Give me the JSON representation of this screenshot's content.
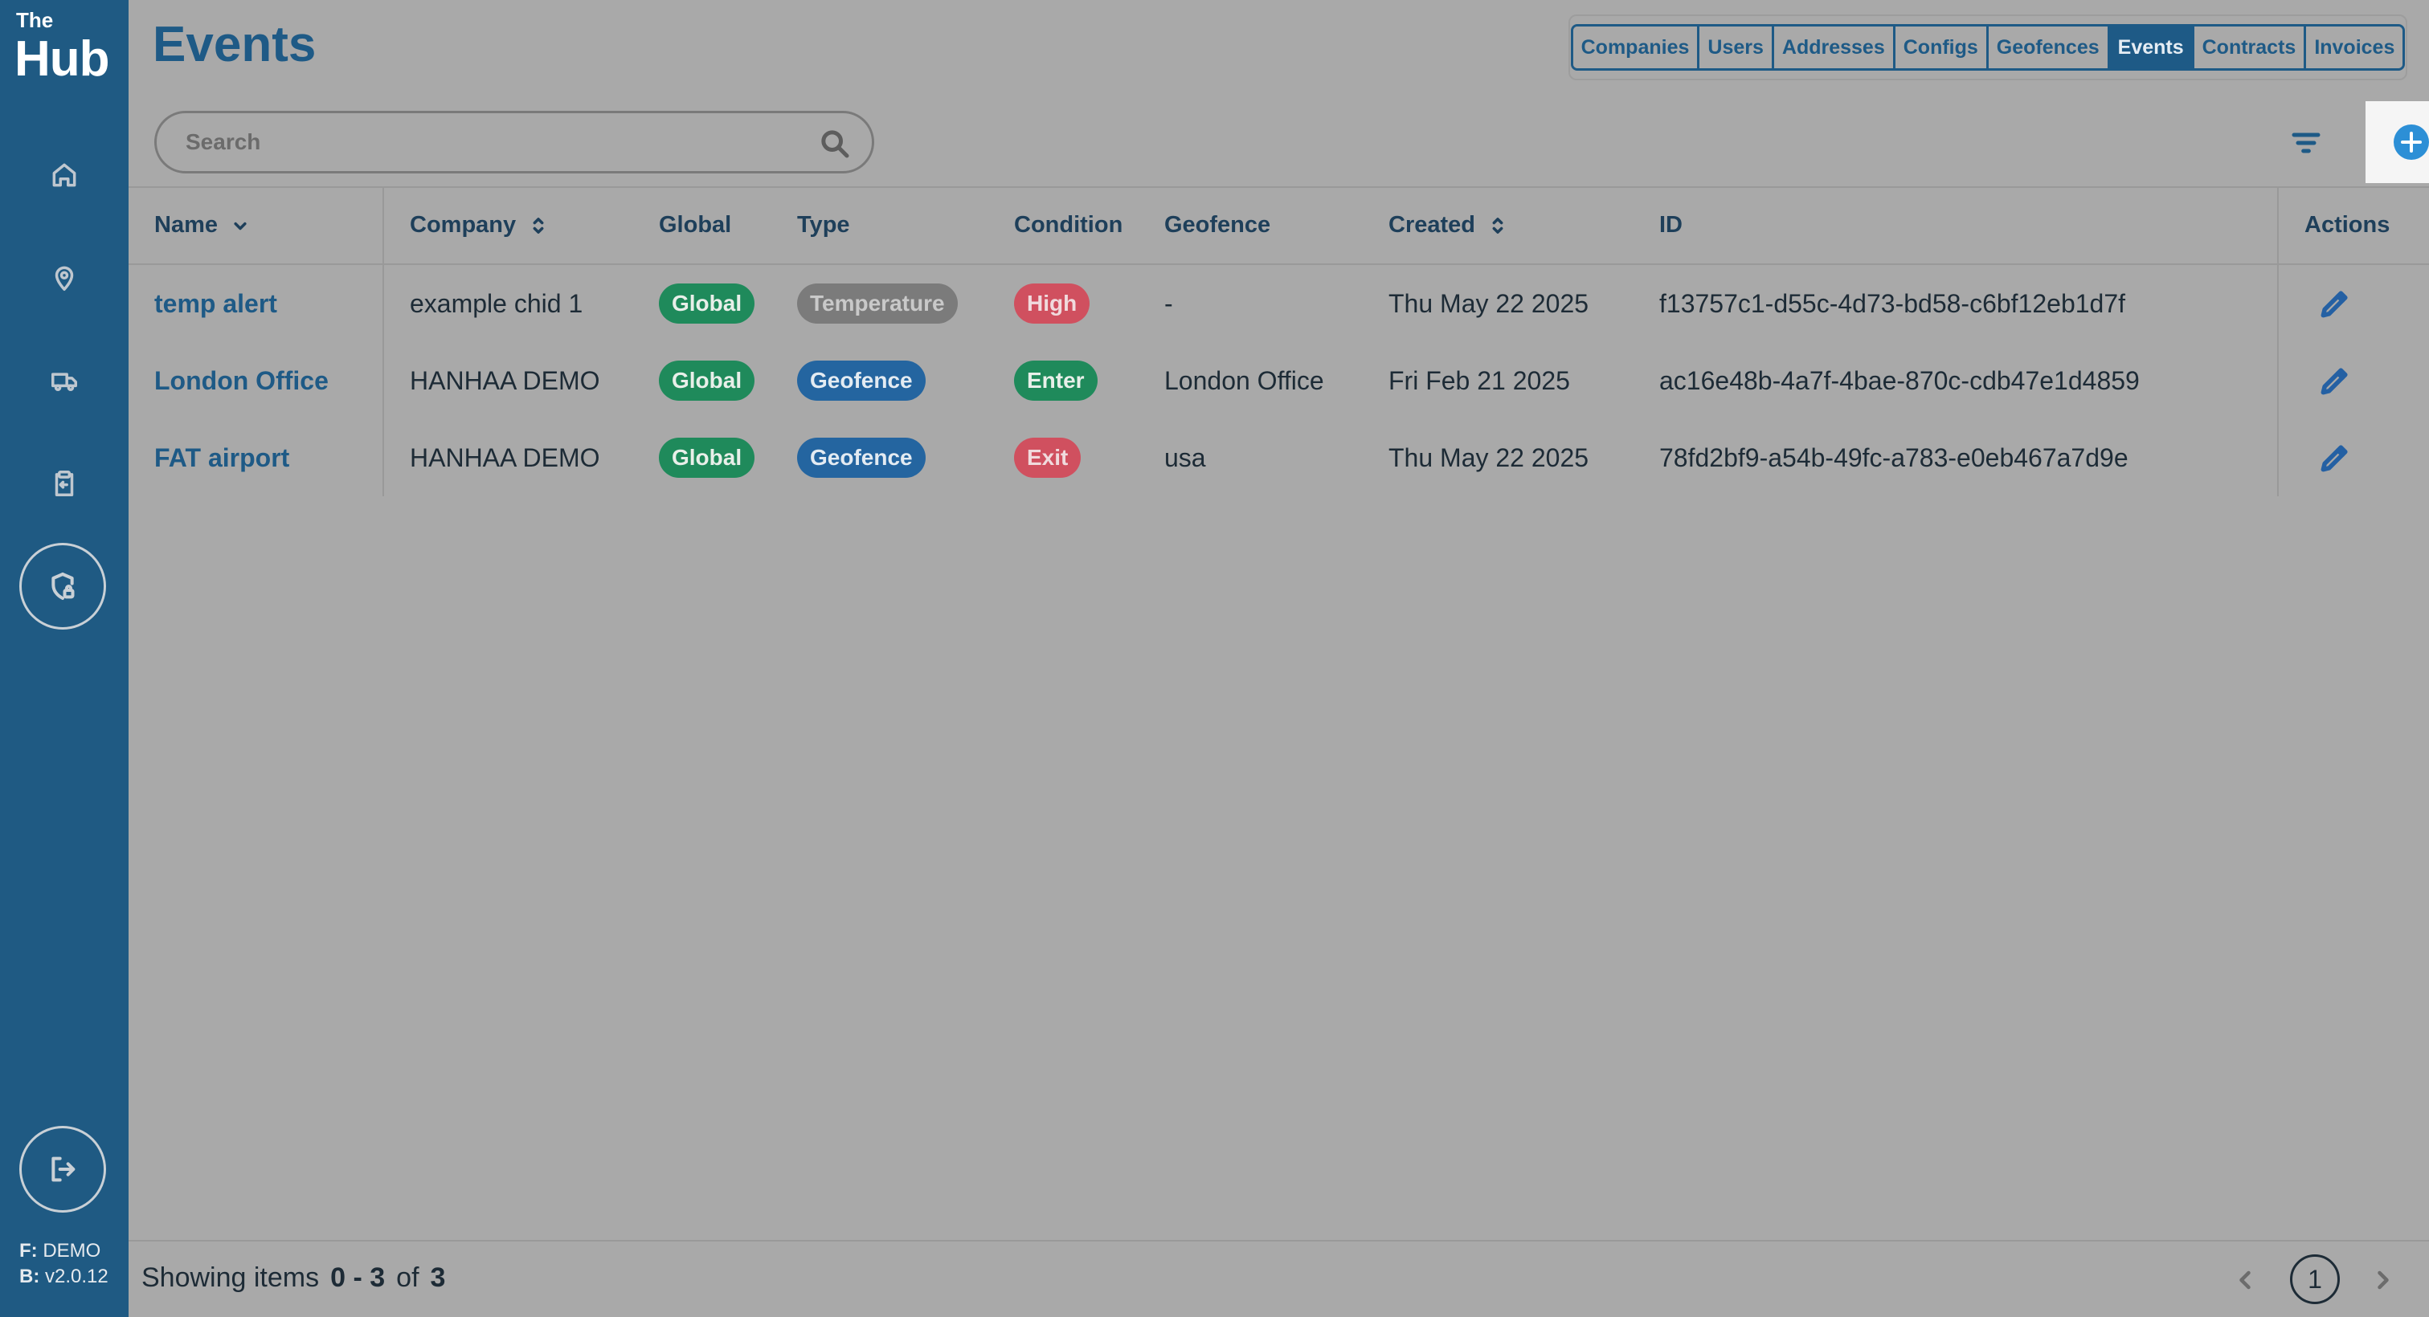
{
  "app": {
    "logo_top": "The",
    "logo_main": "Hub"
  },
  "sidebar": {
    "items": [
      {
        "icon": "home-icon"
      },
      {
        "icon": "map-pin-icon"
      },
      {
        "icon": "truck-icon"
      },
      {
        "icon": "clipboard-icon"
      },
      {
        "icon": "shield-lock-icon",
        "active": true
      }
    ],
    "logout_icon": "logout-icon",
    "frontend_label": "F:",
    "frontend_value": "DEMO",
    "backend_label": "B:",
    "backend_value": "v2.0.12"
  },
  "page": {
    "title": "Events"
  },
  "entity_tabs": [
    {
      "label": "Companies"
    },
    {
      "label": "Users"
    },
    {
      "label": "Addresses"
    },
    {
      "label": "Configs"
    },
    {
      "label": "Geofences"
    },
    {
      "label": "Events",
      "active": true
    },
    {
      "label": "Contracts"
    },
    {
      "label": "Invoices"
    }
  ],
  "search": {
    "placeholder": "Search",
    "value": ""
  },
  "table": {
    "headers": {
      "name": "Name",
      "company": "Company",
      "global": "Global",
      "type": "Type",
      "condition": "Condition",
      "geofence": "Geofence",
      "created": "Created",
      "id": "ID",
      "actions": "Actions"
    },
    "rows": [
      {
        "name": "temp alert",
        "company": "example chid 1",
        "global": "Global",
        "type": "Temperature",
        "condition": "High",
        "geofence": "-",
        "created": "Thu May 22 2025",
        "id": "f13757c1-d55c-4d73-bd58-c6bf12eb1d7f"
      },
      {
        "name": "London Office",
        "company": "HANHAA DEMO",
        "global": "Global",
        "type": "Geofence",
        "condition": "Enter",
        "geofence": "London Office",
        "created": "Fri Feb 21 2025",
        "id": "ac16e48b-4a7f-4bae-870c-cdb47e1d4859"
      },
      {
        "name": "FAT airport",
        "company": "HANHAA DEMO",
        "global": "Global",
        "type": "Geofence",
        "condition": "Exit",
        "geofence": "usa",
        "created": "Thu May 22 2025",
        "id": "78fd2bf9-a54b-49fc-a783-e0eb467a7d9e"
      }
    ]
  },
  "footer": {
    "showing_label": "Showing items",
    "range": "0 - 3",
    "of_label": "of",
    "total": "3",
    "current_page": "1"
  },
  "colors": {
    "sidebar": "#1f5a83",
    "accent": "#1e5a86",
    "badge_green": "#1f8a5b",
    "badge_blue": "#2465a0",
    "badge_grey": "#7b7b7b",
    "badge_red": "#d0505f",
    "add_button": "#2c8fd6"
  }
}
